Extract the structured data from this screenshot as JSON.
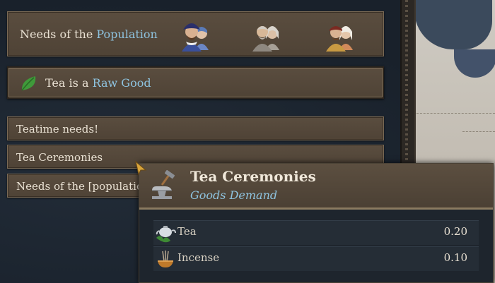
{
  "needs_panel": {
    "title_prefix": "Needs of the ",
    "title_highlight": "Population",
    "portrait_groups": [
      "nobles-portrait-group",
      "peasants-elderly-portrait-group",
      "burghers-portrait-group"
    ]
  },
  "raw_good": {
    "prefix": "Tea is a ",
    "highlight": "Raw Good",
    "icon": "tea-leaf-icon"
  },
  "rows": [
    {
      "label": "Teatime needs!"
    },
    {
      "label": "Tea Ceremonies"
    },
    {
      "label": "Needs of the [population"
    }
  ],
  "tooltip": {
    "title": "Tea Ceremonies",
    "subtitle": "Goods Demand",
    "icon": "anvil-hammer-icon",
    "goods": [
      {
        "name": "Tea",
        "value": "0.20",
        "icon": "teapot-icon"
      },
      {
        "name": "Incense",
        "value": "0.10",
        "icon": "incense-icon"
      }
    ]
  },
  "colors": {
    "highlight": "#8ec3df",
    "panel": "#55483a",
    "text": "#e9e1d3"
  }
}
